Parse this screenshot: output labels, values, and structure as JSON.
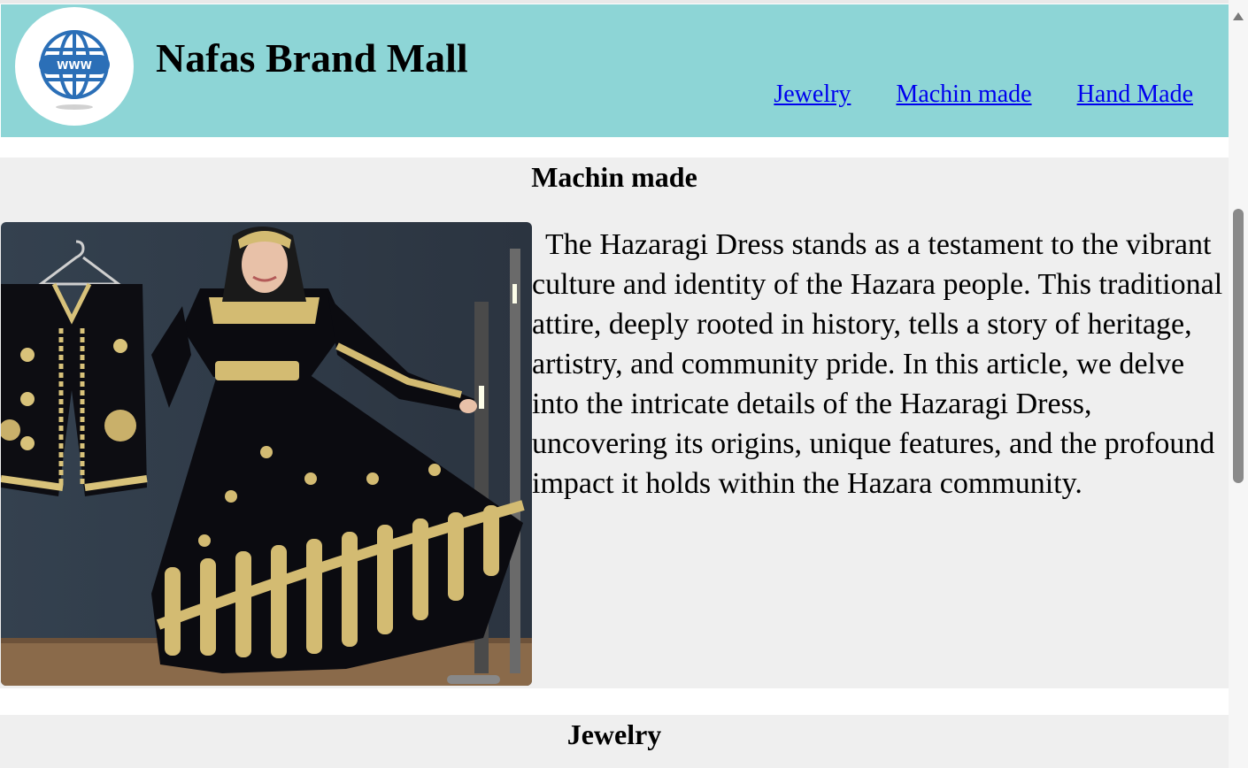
{
  "header": {
    "logo_icon": "globe-www-icon",
    "logo_text": "WWW",
    "brand": "Nafas Brand Mall",
    "nav": [
      {
        "label": "Jewelry"
      },
      {
        "label": "Machin made"
      },
      {
        "label": "Hand Made"
      }
    ]
  },
  "sections": [
    {
      "title": "Machin made",
      "image_alt": "Hazaragi dress",
      "description": "The Hazaragi Dress stands as a testament to the vibrant culture and identity of the Hazara people. This traditional attire, deeply rooted in history, tells a story of heritage, artistry, and community pride. In this article, we delve into the intricate details of the Hazaragi Dress, uncovering its origins, unique features, and the profound impact it holds within the Hazara community."
    },
    {
      "title": "Jewelry"
    }
  ],
  "colors": {
    "header_bg": "#8dd5d6",
    "section_bg": "#efefef",
    "link": "#0000ee",
    "logo_blue": "#2b6fb7"
  }
}
